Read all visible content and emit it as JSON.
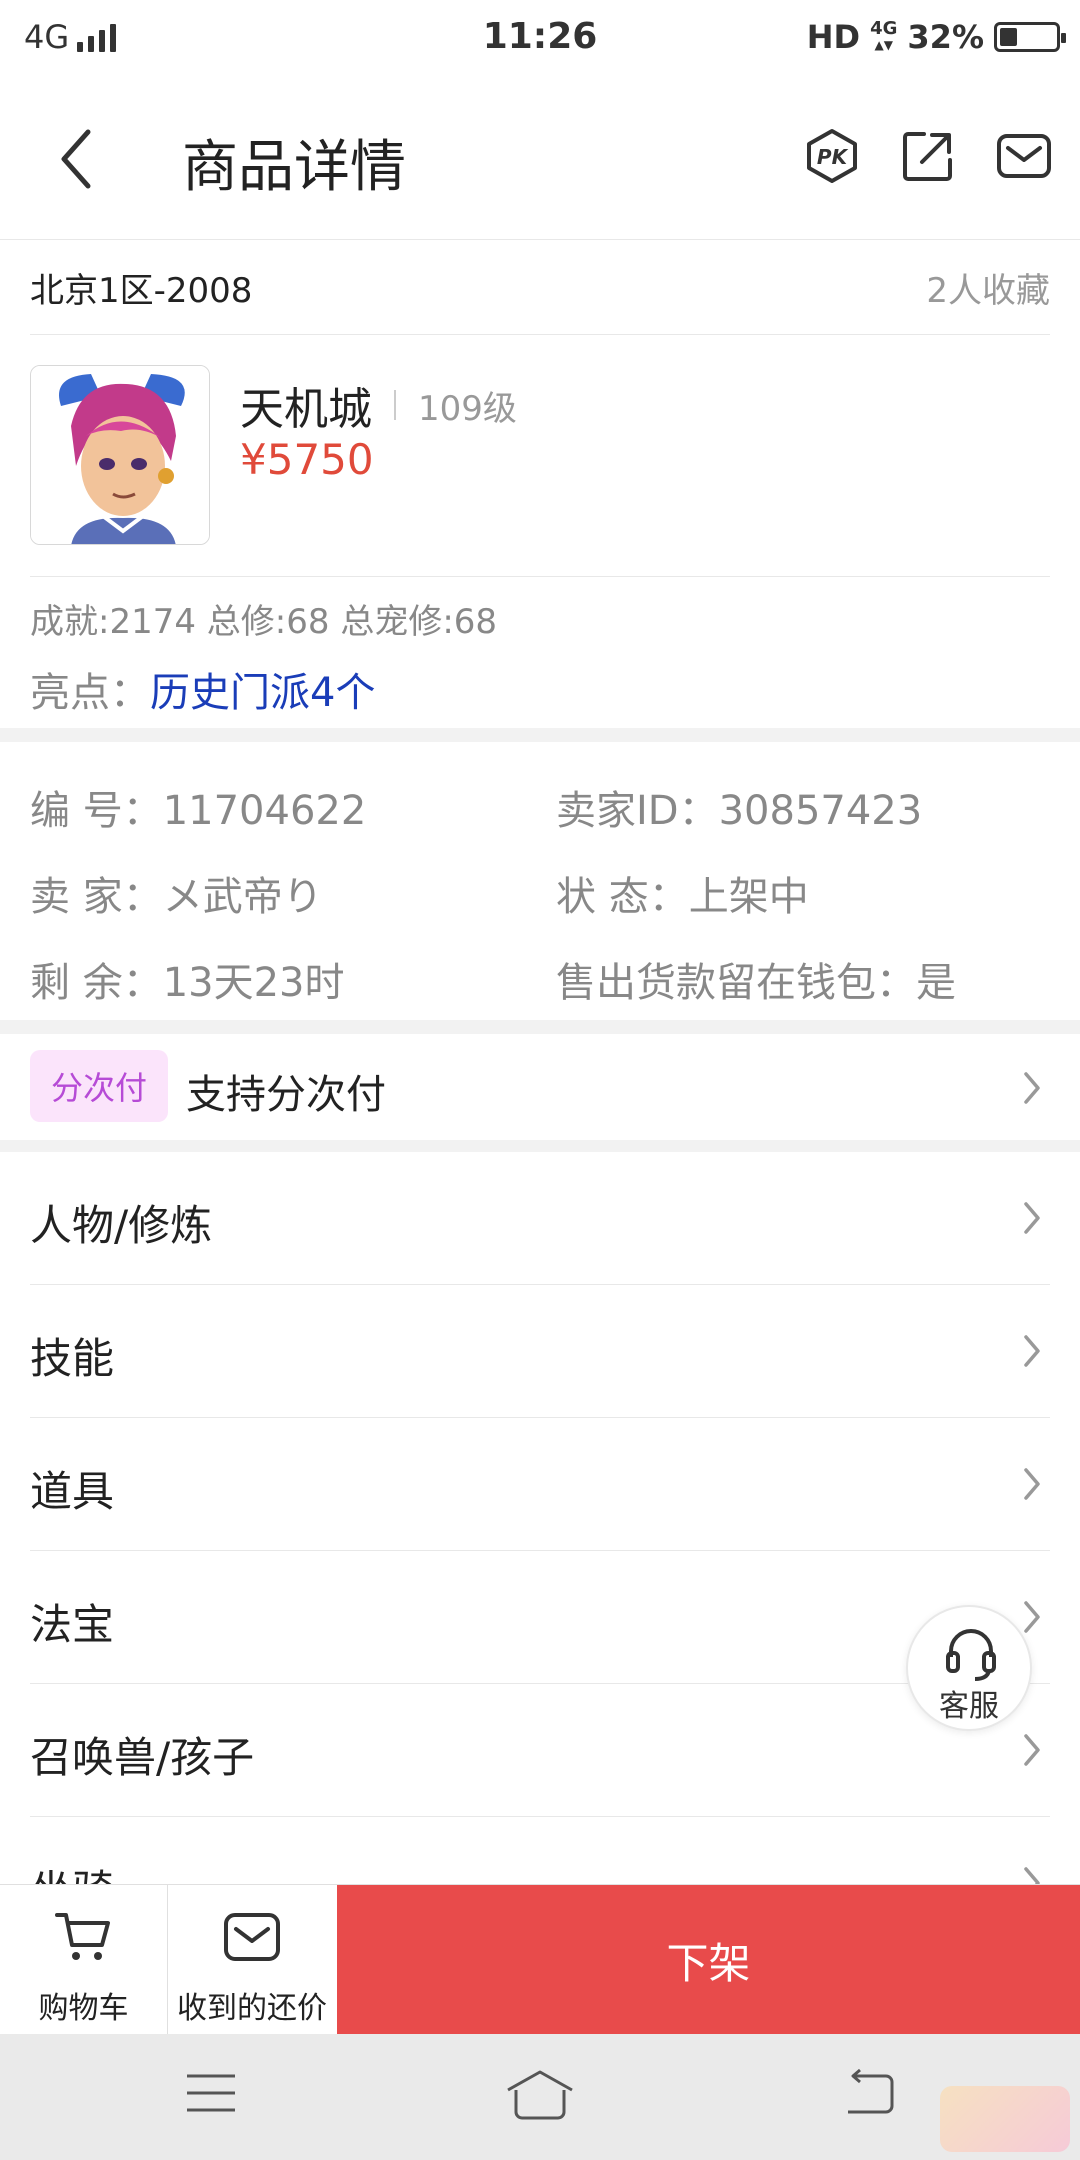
{
  "status_bar": {
    "network": "4G",
    "time": "11:26",
    "hd": "HD",
    "net_small": "4G",
    "battery": "32%",
    "battery_level": 0.32
  },
  "nav": {
    "title": "商品详情",
    "icons": [
      "back-arrow-icon",
      "pk-icon",
      "share-icon",
      "mail-icon"
    ]
  },
  "server": {
    "name": "北京1区-2008",
    "favorites": "2人收藏"
  },
  "product": {
    "name": "天机城",
    "level": "109级",
    "price": "¥5750",
    "stats": "成就:2174 总修:68 总宠修:68",
    "highlight_label": "亮点：",
    "highlight_value": "历史门派4个"
  },
  "info": {
    "id": "编  号：11704622",
    "seller_id": "卖家ID：30857423",
    "seller": "卖  家：メ武帝り",
    "status": "状  态：上架中",
    "remaining": "剩  余：13天23时",
    "wallet": "售出货款留在钱包：是"
  },
  "installment": {
    "tag": "分次付",
    "text": "支持分次付"
  },
  "menu": [
    {
      "label": "人物/修炼"
    },
    {
      "label": "技能"
    },
    {
      "label": "道具"
    },
    {
      "label": "法宝"
    },
    {
      "label": "召唤兽/孩子"
    },
    {
      "label": "坐骑"
    }
  ],
  "service": {
    "label": "客服"
  },
  "actions": {
    "cart": "购物车",
    "offers": "收到的还价",
    "main": "下架"
  },
  "colors": {
    "price": "#e04a3a",
    "highlight": "#1a3db8",
    "primary_button": "#e84b4b",
    "tag_bg": "#fbe4fb",
    "tag_text": "#b64bd6"
  }
}
